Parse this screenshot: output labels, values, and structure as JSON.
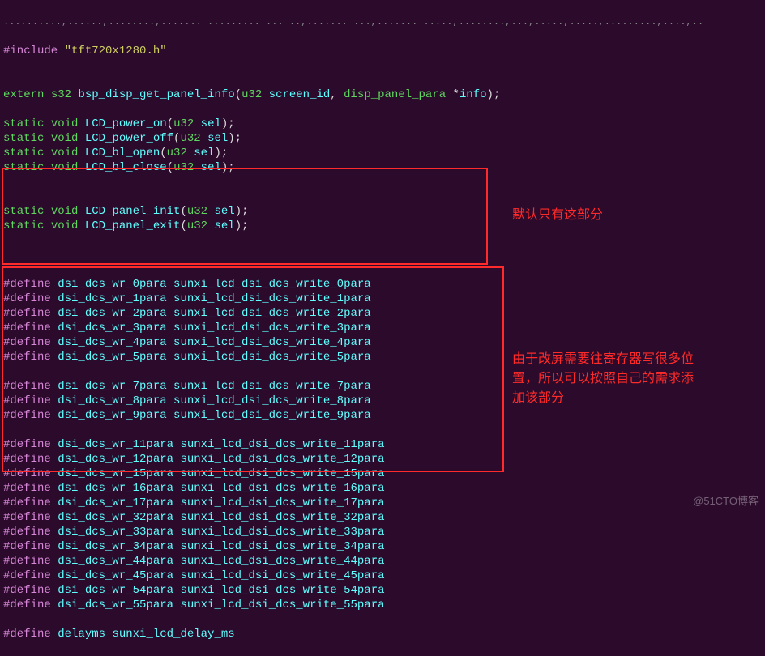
{
  "header_dim": "..........,......,........,....... ......... ... ..,....... ...,....... .....,........,...,.....,.....,.........,....,..",
  "include_kw": "#include ",
  "include_str": "\"tft720x1280.h\"",
  "blank": "",
  "extern_line": {
    "kw": "extern ",
    "type1": "s32 ",
    "fn": "bsp_disp_get_panel_info",
    "p1": "(",
    "type2": "u32 ",
    "arg1": "screen_id",
    "comma": ", ",
    "type3": "disp_panel_para ",
    "star": "*",
    "arg2": "info",
    "p2": ");"
  },
  "static_lines": [
    {
      "kw": "static ",
      "type": "void ",
      "fn": "LCD_power_on",
      "p1": "(",
      "atype": "u32 ",
      "arg": "sel",
      "p2": ");"
    },
    {
      "kw": "static ",
      "type": "void ",
      "fn": "LCD_power_off",
      "p1": "(",
      "atype": "u32 ",
      "arg": "sel",
      "p2": ");"
    },
    {
      "kw": "static ",
      "type": "void ",
      "fn": "LCD_bl_open",
      "p1": "(",
      "atype": "u32 ",
      "arg": "sel",
      "p2": ");"
    },
    {
      "kw": "static ",
      "type": "void ",
      "fn": "LCD_bl_close",
      "p1": "(",
      "atype": "u32 ",
      "arg": "sel",
      "p2": ");"
    }
  ],
  "static_lines2": [
    {
      "kw": "static ",
      "type": "void ",
      "fn": "LCD_panel_init",
      "p1": "(",
      "atype": "u32 ",
      "arg": "sel",
      "p2": ");"
    },
    {
      "kw": "static ",
      "type": "void ",
      "fn": "LCD_panel_exit",
      "p1": "(",
      "atype": "u32 ",
      "arg": "sel",
      "p2": ");"
    }
  ],
  "defines_group1": [
    {
      "kw": "#define ",
      "name": "dsi_dcs_wr_0para ",
      "val": "sunxi_lcd_dsi_dcs_write_0para"
    },
    {
      "kw": "#define ",
      "name": "dsi_dcs_wr_1para ",
      "val": "sunxi_lcd_dsi_dcs_write_1para"
    },
    {
      "kw": "#define ",
      "name": "dsi_dcs_wr_2para ",
      "val": "sunxi_lcd_dsi_dcs_write_2para"
    },
    {
      "kw": "#define ",
      "name": "dsi_dcs_wr_3para ",
      "val": "sunxi_lcd_dsi_dcs_write_3para"
    },
    {
      "kw": "#define ",
      "name": "dsi_dcs_wr_4para ",
      "val": "sunxi_lcd_dsi_dcs_write_4para"
    },
    {
      "kw": "#define ",
      "name": "dsi_dcs_wr_5para ",
      "val": "sunxi_lcd_dsi_dcs_write_5para"
    }
  ],
  "defines_group1b": [
    {
      "kw": "#define ",
      "name": "dsi_dcs_wr_7para ",
      "val": "sunxi_lcd_dsi_dcs_write_7para"
    },
    {
      "kw": "#define ",
      "name": "dsi_dcs_wr_8para ",
      "val": "sunxi_lcd_dsi_dcs_write_8para"
    },
    {
      "kw": "#define ",
      "name": "dsi_dcs_wr_9para ",
      "val": "sunxi_lcd_dsi_dcs_write_9para"
    }
  ],
  "defines_group2": [
    {
      "kw": "#define ",
      "name": "dsi_dcs_wr_11para ",
      "val": "sunxi_lcd_dsi_dcs_write_11para"
    },
    {
      "kw": "#define ",
      "name": "dsi_dcs_wr_12para ",
      "val": "sunxi_lcd_dsi_dcs_write_12para"
    },
    {
      "kw": "#define ",
      "name": "dsi_dcs_wr_15para ",
      "val": "sunxi_lcd_dsi_dcs_write_15para"
    },
    {
      "kw": "#define ",
      "name": "dsi_dcs_wr_16para ",
      "val": "sunxi_lcd_dsi_dcs_write_16para"
    },
    {
      "kw": "#define ",
      "name": "dsi_dcs_wr_17para ",
      "val": "sunxi_lcd_dsi_dcs_write_17para"
    },
    {
      "kw": "#define ",
      "name": "dsi_dcs_wr_32para ",
      "val": "sunxi_lcd_dsi_dcs_write_32para"
    },
    {
      "kw": "#define ",
      "name": "dsi_dcs_wr_33para ",
      "val": "sunxi_lcd_dsi_dcs_write_33para"
    },
    {
      "kw": "#define ",
      "name": "dsi_dcs_wr_34para ",
      "val": "sunxi_lcd_dsi_dcs_write_34para"
    },
    {
      "kw": "#define ",
      "name": "dsi_dcs_wr_44para ",
      "val": "sunxi_lcd_dsi_dcs_write_44para"
    },
    {
      "kw": "#define ",
      "name": "dsi_dcs_wr_45para ",
      "val": "sunxi_lcd_dsi_dcs_write_45para"
    },
    {
      "kw": "#define ",
      "name": "dsi_dcs_wr_54para ",
      "val": "sunxi_lcd_dsi_dcs_write_54para"
    },
    {
      "kw": "#define ",
      "name": "dsi_dcs_wr_55para ",
      "val": "sunxi_lcd_dsi_dcs_write_55para"
    }
  ],
  "define_delayms": {
    "kw": "#define ",
    "name": "delayms ",
    "val": "sunxi_lcd_delay_ms"
  },
  "annotation1": "默认只有这部分",
  "annotation2": "由于改屏需要往寄存器写很多位置，所以可以按照自己的需求添加该部分",
  "watermark": "@51CTO博客"
}
